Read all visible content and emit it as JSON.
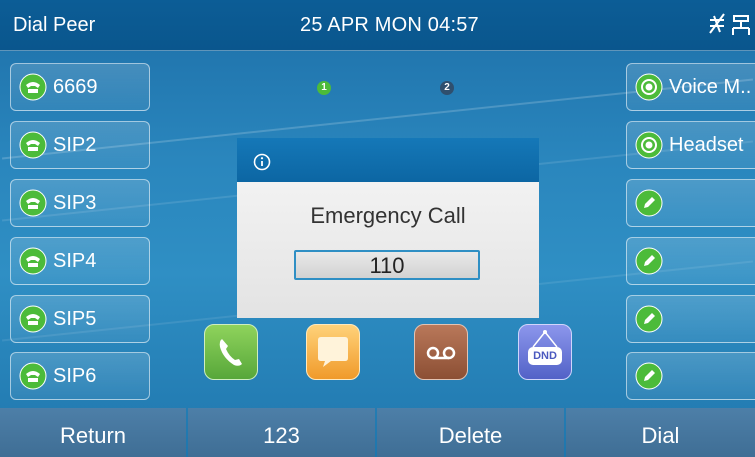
{
  "status_bar": {
    "title": "Dial Peer",
    "datetime": "25 APR MON  04:57",
    "icons": [
      "network-disconnected-icon",
      "network-cable-icon"
    ]
  },
  "line_keys_left": [
    {
      "label": "6669",
      "icon": "phone-icon"
    },
    {
      "label": "SIP2",
      "icon": "phone-icon"
    },
    {
      "label": "SIP3",
      "icon": "phone-icon"
    },
    {
      "label": "SIP4",
      "icon": "phone-icon"
    },
    {
      "label": "SIP5",
      "icon": "phone-icon"
    },
    {
      "label": "SIP6",
      "icon": "phone-icon"
    }
  ],
  "line_keys_right": [
    {
      "label": "Voice M..",
      "icon": "radio-icon"
    },
    {
      "label": "Headset",
      "icon": "radio-icon"
    },
    {
      "label": "",
      "icon": "edit-icon"
    },
    {
      "label": "",
      "icon": "edit-icon"
    },
    {
      "label": "",
      "icon": "edit-icon"
    },
    {
      "label": "",
      "icon": "edit-icon"
    }
  ],
  "pages": [
    {
      "number": "1",
      "active": true,
      "color": "#4cbb3a"
    },
    {
      "number": "2",
      "active": false,
      "color": "#2f4f6e"
    }
  ],
  "dialog": {
    "icon": "info-icon",
    "title": "Emergency Call",
    "number": "110"
  },
  "dock": [
    {
      "name": "phone-app-icon",
      "label": "",
      "color": "#6cc04a"
    },
    {
      "name": "message-app-icon",
      "label": "",
      "color": "#f0a530"
    },
    {
      "name": "voicemail-app-icon",
      "label": "",
      "color": "#9a5a3e"
    },
    {
      "name": "dnd-app-icon",
      "label": "DND",
      "color": "#5f6fd0"
    }
  ],
  "softkeys": [
    "Return",
    "123",
    "Delete",
    "Dial"
  ],
  "colors": {
    "background": "#2a86bd",
    "status_bar": "#0c5d96",
    "dialog_header": "#1578b8",
    "phone_green": "#4cbb3a",
    "softkey": "#4a7aa3"
  }
}
